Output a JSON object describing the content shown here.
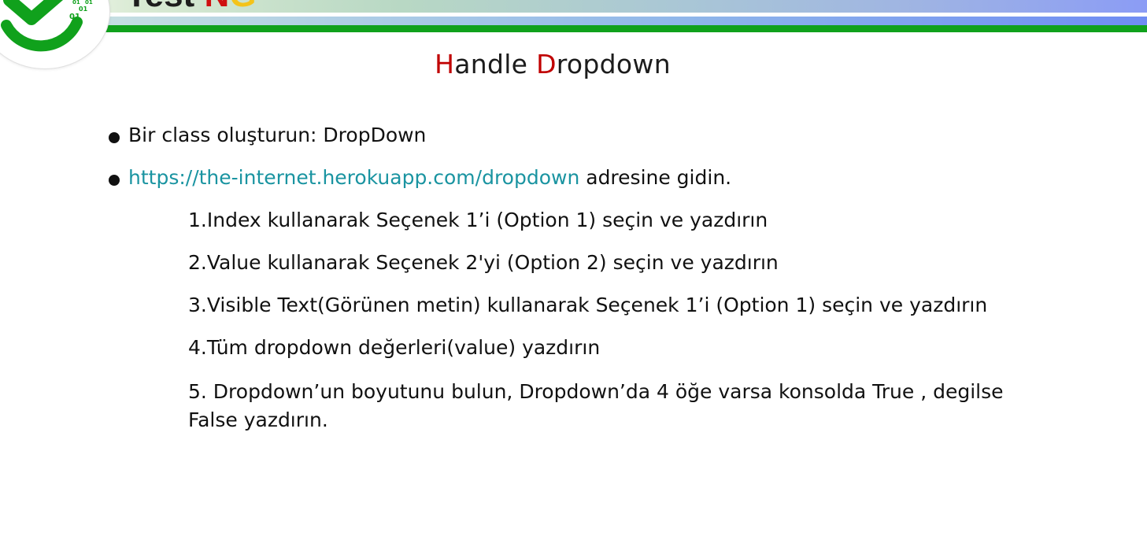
{
  "header": {
    "logo_title_part1": "Test ",
    "logo_title_part2": "N",
    "logo_title_part3": "G",
    "logo_digits": [
      "01",
      "01",
      "01",
      "01"
    ]
  },
  "slide": {
    "title_h": "H",
    "title_rest1": "andle ",
    "title_d": "D",
    "title_rest2": "ropdown"
  },
  "bullets": [
    {
      "text": "Bir class oluşturun: DropDown"
    },
    {
      "link": "https://the-internet.herokuapp.com/dropdown",
      "text": " adresine gidin."
    }
  ],
  "steps": [
    "1.Index kullanarak Seçenek 1’i (Option 1) seçin ve yazdırın",
    "2.Value kullanarak Seçenek 2'yi (Option 2) seçin ve yazdırın",
    "3.Visible Text(Görünen metin) kullanarak Seçenek 1’i (Option 1) seçin ve yazdırın",
    "4.Tüm dropdown değerleri(value) yazdırın",
    "5. Dropdown’un boyutunu bulun, Dropdown’da 4 öğe varsa konsolda True , degilse False yazdırın."
  ],
  "colors": {
    "title_accent": "#c00000",
    "link": "#1a94a1",
    "brand_green": "#10a11c"
  }
}
